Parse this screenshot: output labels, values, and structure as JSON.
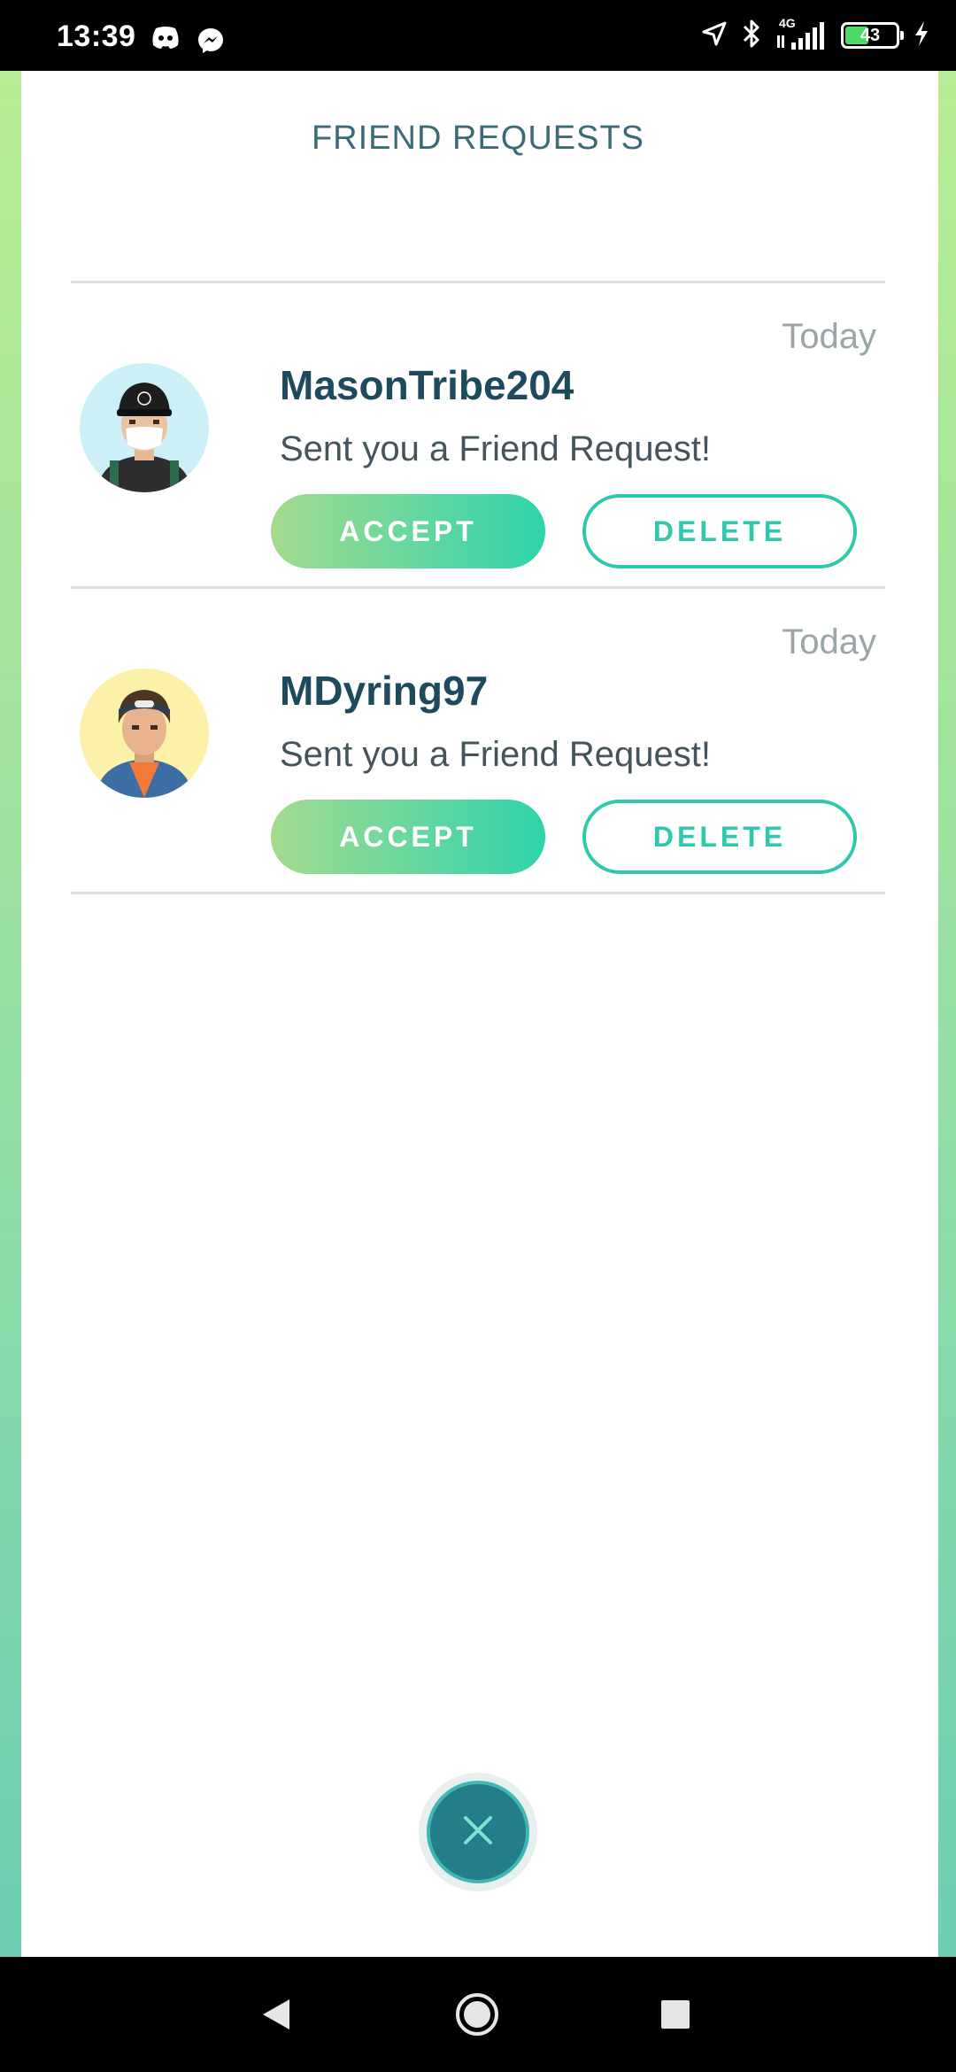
{
  "status_bar": {
    "time": "13:39",
    "network": "4G",
    "battery": "43",
    "icons": [
      "discord-icon",
      "messenger-icon",
      "location-icon",
      "bluetooth-icon",
      "signal-icon",
      "battery-icon",
      "charging-icon"
    ]
  },
  "page": {
    "title": "FRIEND REQUESTS"
  },
  "requests": [
    {
      "date": "Today",
      "name": "MasonTribe204",
      "message": "Sent you a Friend Request!",
      "accept_label": "ACCEPT",
      "delete_label": "DELETE",
      "avatar_bg": "#cdeff7"
    },
    {
      "date": "Today",
      "name": "MDyring97",
      "message": "Sent you a Friend Request!",
      "accept_label": "ACCEPT",
      "delete_label": "DELETE",
      "avatar_bg": "#fbf1a8"
    }
  ],
  "colors": {
    "accent": "#2fc8ad",
    "title": "#3b6b77",
    "name": "#1d4a5c",
    "close_button": "#247e8a"
  },
  "nav": {
    "icons": [
      "back-icon",
      "home-icon",
      "recents-icon"
    ]
  }
}
